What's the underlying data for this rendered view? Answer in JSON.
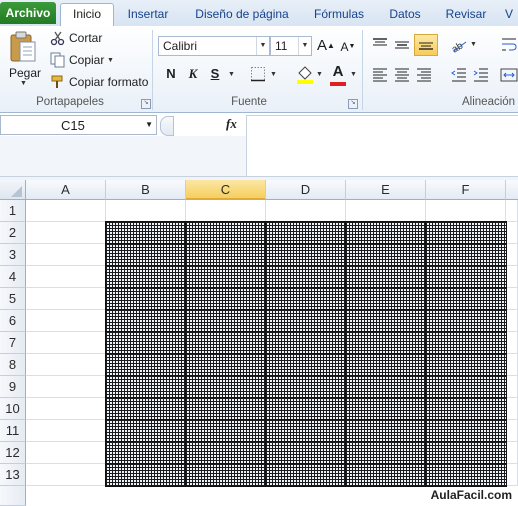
{
  "tabs": [
    "Archivo",
    "Inicio",
    "Insertar",
    "Diseño de página",
    "Fórmulas",
    "Datos",
    "Revisar",
    "V"
  ],
  "active_tab": "Inicio",
  "clipboard": {
    "paste_label": "Pegar",
    "cut_label": "Cortar",
    "copy_label": "Copiar",
    "format_painter_label": "Copiar formato",
    "group_label": "Portapapeles"
  },
  "font": {
    "font_name": "Calibri",
    "font_size": "11",
    "bold": "N",
    "italic": "K",
    "underline": "S",
    "grow_label": "A",
    "shrink_label": "A",
    "font_color_label": "A",
    "group_label": "Fuente"
  },
  "alignment": {
    "group_label": "Alineación"
  },
  "formula_bar": {
    "name_box": "C15",
    "fx_label": "fx",
    "formula_value": ""
  },
  "grid": {
    "columns": [
      "A",
      "B",
      "C",
      "D",
      "E",
      "F"
    ],
    "selected_column": "C",
    "rows": [
      "1",
      "2",
      "3",
      "4",
      "5",
      "6",
      "7",
      "8",
      "9",
      "10",
      "11",
      "12",
      "13"
    ]
  },
  "colors": {
    "file_tab": "#2a8a2a",
    "selection": "#f6cf5e",
    "font_color": "#e02020",
    "fill_color": "#ffff00"
  },
  "watermark": "AulaFacil.com"
}
